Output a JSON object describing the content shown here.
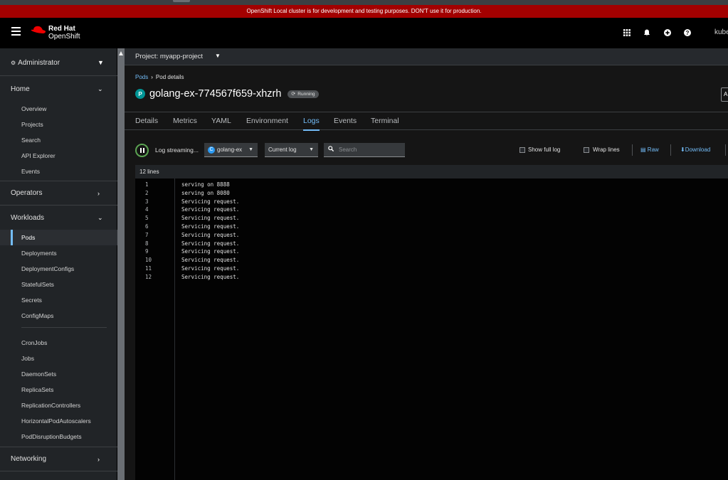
{
  "banner": {
    "text": "OpenShift Local cluster is for development and testing purposes. DON'T use it for production."
  },
  "masthead": {
    "brand_line1": "Red Hat",
    "brand_line2": "OpenShift",
    "icons": [
      "grid-icon",
      "bell-icon",
      "plus-circle-icon",
      "help-icon"
    ],
    "user": "kube"
  },
  "sidebar": {
    "perspective": "Administrator",
    "sections": [
      {
        "label": "Home",
        "expanded": true,
        "items": [
          "Overview",
          "Projects",
          "Search",
          "API Explorer",
          "Events"
        ]
      },
      {
        "label": "Operators",
        "expanded": false,
        "items": []
      },
      {
        "label": "Workloads",
        "expanded": true,
        "items": [
          "Pods",
          "Deployments",
          "DeploymentConfigs",
          "StatefulSets",
          "Secrets",
          "ConfigMaps"
        ],
        "items2": [
          "CronJobs",
          "Jobs",
          "DaemonSets",
          "ReplicaSets",
          "ReplicationControllers",
          "HorizontalPodAutoscalers",
          "PodDisruptionBudgets"
        ],
        "active": "Pods"
      },
      {
        "label": "Networking",
        "expanded": false,
        "items": []
      }
    ]
  },
  "project_bar": {
    "label": "Project: myapp-project"
  },
  "breadcrumb": {
    "link": "Pods",
    "current": "Pod details"
  },
  "pod": {
    "badge": "P",
    "name": "golang-ex-774567f659-xhzrh",
    "status": "Running",
    "actions_label": "A"
  },
  "tabs": [
    "Details",
    "Metrics",
    "YAML",
    "Environment",
    "Logs",
    "Events",
    "Terminal"
  ],
  "active_tab": "Logs",
  "toolbar": {
    "streaming": "Log streaming...",
    "container_badge": "C",
    "container": "golang-ex",
    "log_select": "Current log",
    "search_placeholder": "Search",
    "show_full_log": "Show full log",
    "wrap_lines": "Wrap lines",
    "raw": "Raw",
    "download": "Download"
  },
  "log": {
    "count_label": "12 lines",
    "lines": [
      {
        "n": "1",
        "text": "serving on 8888"
      },
      {
        "n": "2",
        "text": "serving on 8080"
      },
      {
        "n": "3",
        "text": "Servicing request."
      },
      {
        "n": "4",
        "text": "Servicing request."
      },
      {
        "n": "5",
        "text": "Servicing request."
      },
      {
        "n": "6",
        "text": "Servicing request."
      },
      {
        "n": "7",
        "text": "Servicing request."
      },
      {
        "n": "8",
        "text": "Servicing request."
      },
      {
        "n": "9",
        "text": "Servicing request."
      },
      {
        "n": "10",
        "text": "Servicing request."
      },
      {
        "n": "11",
        "text": "Servicing request."
      },
      {
        "n": "12",
        "text": "Servicing request."
      }
    ]
  },
  "colors": {
    "banner": "#a30000",
    "accent": "#73bcf7",
    "pod_badge": "#009596",
    "streaming": "#5ba352"
  }
}
